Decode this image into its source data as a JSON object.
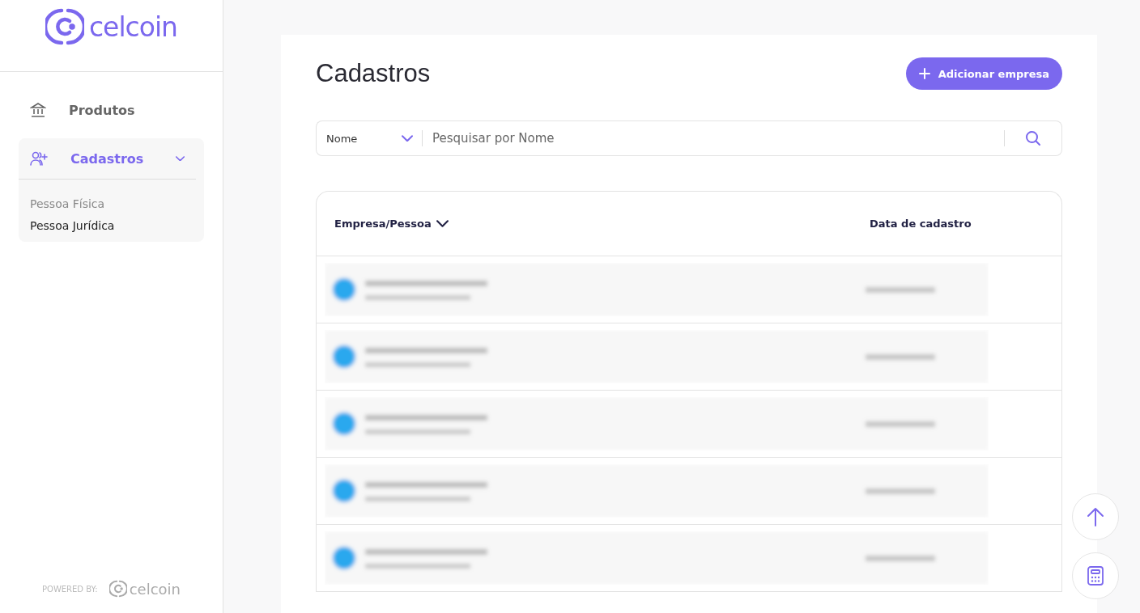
{
  "sidebar": {
    "logo": "celcoin",
    "items": [
      {
        "label": "Produtos",
        "kind": "bank",
        "selected": false
      },
      {
        "label": "Cadastros",
        "kind": "people",
        "selected": true,
        "expanded": true,
        "children": [
          {
            "label": "Pessoa Física",
            "selected": false
          },
          {
            "label": "Pessoa Jurídica",
            "selected": true
          }
        ]
      }
    ],
    "footer": {
      "label": "POWERED BY:",
      "logo": "celcoin"
    }
  },
  "page": {
    "title": "Cadastros",
    "add_button": "Adicionar empresa"
  },
  "search": {
    "filter": "Nome",
    "placeholder": "Pesquisar por Nome"
  },
  "table": {
    "columns": [
      {
        "label": "Empresa/Pessoa",
        "sortable": true
      },
      {
        "label": "Data de cadastro",
        "sortable": false
      }
    ],
    "rows": [
      {
        "kind": "blurred"
      },
      {
        "kind": "blurred"
      },
      {
        "kind": "blurred"
      },
      {
        "kind": "blurred"
      },
      {
        "kind": "blurred"
      }
    ]
  }
}
